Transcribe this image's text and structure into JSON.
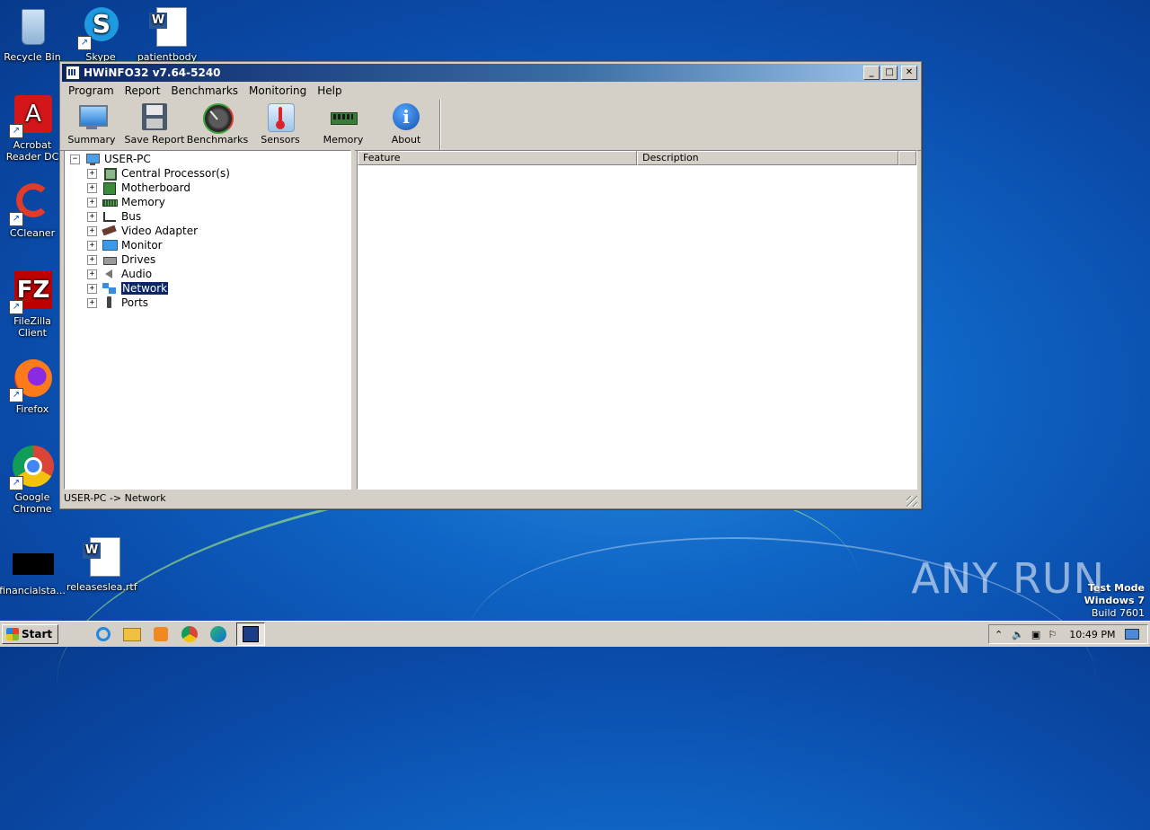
{
  "desktop": {
    "icons": [
      {
        "label": "Recycle Bin"
      },
      {
        "label": "Skype"
      },
      {
        "label": "patientbody"
      },
      {
        "label": "Acrobat Reader DC"
      },
      {
        "label": "CCleaner"
      },
      {
        "label": "FileZilla Client"
      },
      {
        "label": "Firefox"
      },
      {
        "label": "Google Chrome"
      },
      {
        "label": "financialsta..."
      },
      {
        "label": "releaseslea.rtf"
      }
    ]
  },
  "window": {
    "title": "HWiNFO32 v7.64-5240",
    "menu": [
      "Program",
      "Report",
      "Benchmarks",
      "Monitoring",
      "Help"
    ],
    "toolbar": [
      {
        "label": "Summary",
        "icon": "monitor-icon"
      },
      {
        "label": "Save Report",
        "icon": "floppy-icon"
      },
      {
        "label": "Benchmarks",
        "icon": "gauge-icon"
      },
      {
        "label": "Sensors",
        "icon": "thermometer-icon"
      },
      {
        "label": "Memory",
        "icon": "ram-icon"
      },
      {
        "label": "About",
        "icon": "info-icon"
      }
    ],
    "tree": {
      "root": "USER-PC",
      "items": [
        {
          "label": "Central Processor(s)",
          "icon": "cpu-icon"
        },
        {
          "label": "Motherboard",
          "icon": "motherboard-icon"
        },
        {
          "label": "Memory",
          "icon": "ram-icon"
        },
        {
          "label": "Bus",
          "icon": "bus-icon"
        },
        {
          "label": "Video Adapter",
          "icon": "gpu-icon"
        },
        {
          "label": "Monitor",
          "icon": "monitor-icon"
        },
        {
          "label": "Drives",
          "icon": "drive-icon"
        },
        {
          "label": "Audio",
          "icon": "speaker-icon"
        },
        {
          "label": "Network",
          "icon": "network-icon",
          "selected": true
        },
        {
          "label": "Ports",
          "icon": "port-icon"
        }
      ]
    },
    "list": {
      "columns": [
        "Feature",
        "Description"
      ]
    },
    "status": "USER-PC -> Network"
  },
  "taskbar": {
    "start_label": "Start",
    "clock": "10:49 PM"
  },
  "overlay": {
    "watermark": "ANY RUN",
    "test_mode": [
      "Test Mode",
      "Windows 7",
      "Build 7601"
    ]
  }
}
